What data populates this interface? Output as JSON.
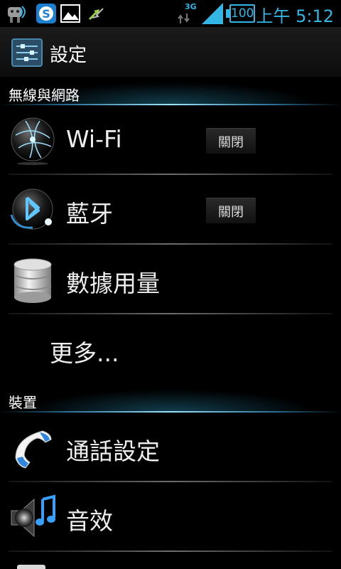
{
  "status_bar": {
    "network_type": "3G",
    "battery_level": "100",
    "time": "上午 5:12"
  },
  "action_bar": {
    "title": "設定"
  },
  "sections": [
    {
      "label": "無線與網路"
    },
    {
      "label": "裝置"
    }
  ],
  "items": [
    {
      "label": "Wi-Fi",
      "toggle": "關閉"
    },
    {
      "label": "藍牙",
      "toggle": "關閉"
    },
    {
      "label": "數據用量"
    },
    {
      "label": "更多..."
    },
    {
      "label": "通話設定"
    },
    {
      "label": "音效"
    }
  ],
  "colors": {
    "accent": "#33b5e5",
    "background": "#000000"
  }
}
